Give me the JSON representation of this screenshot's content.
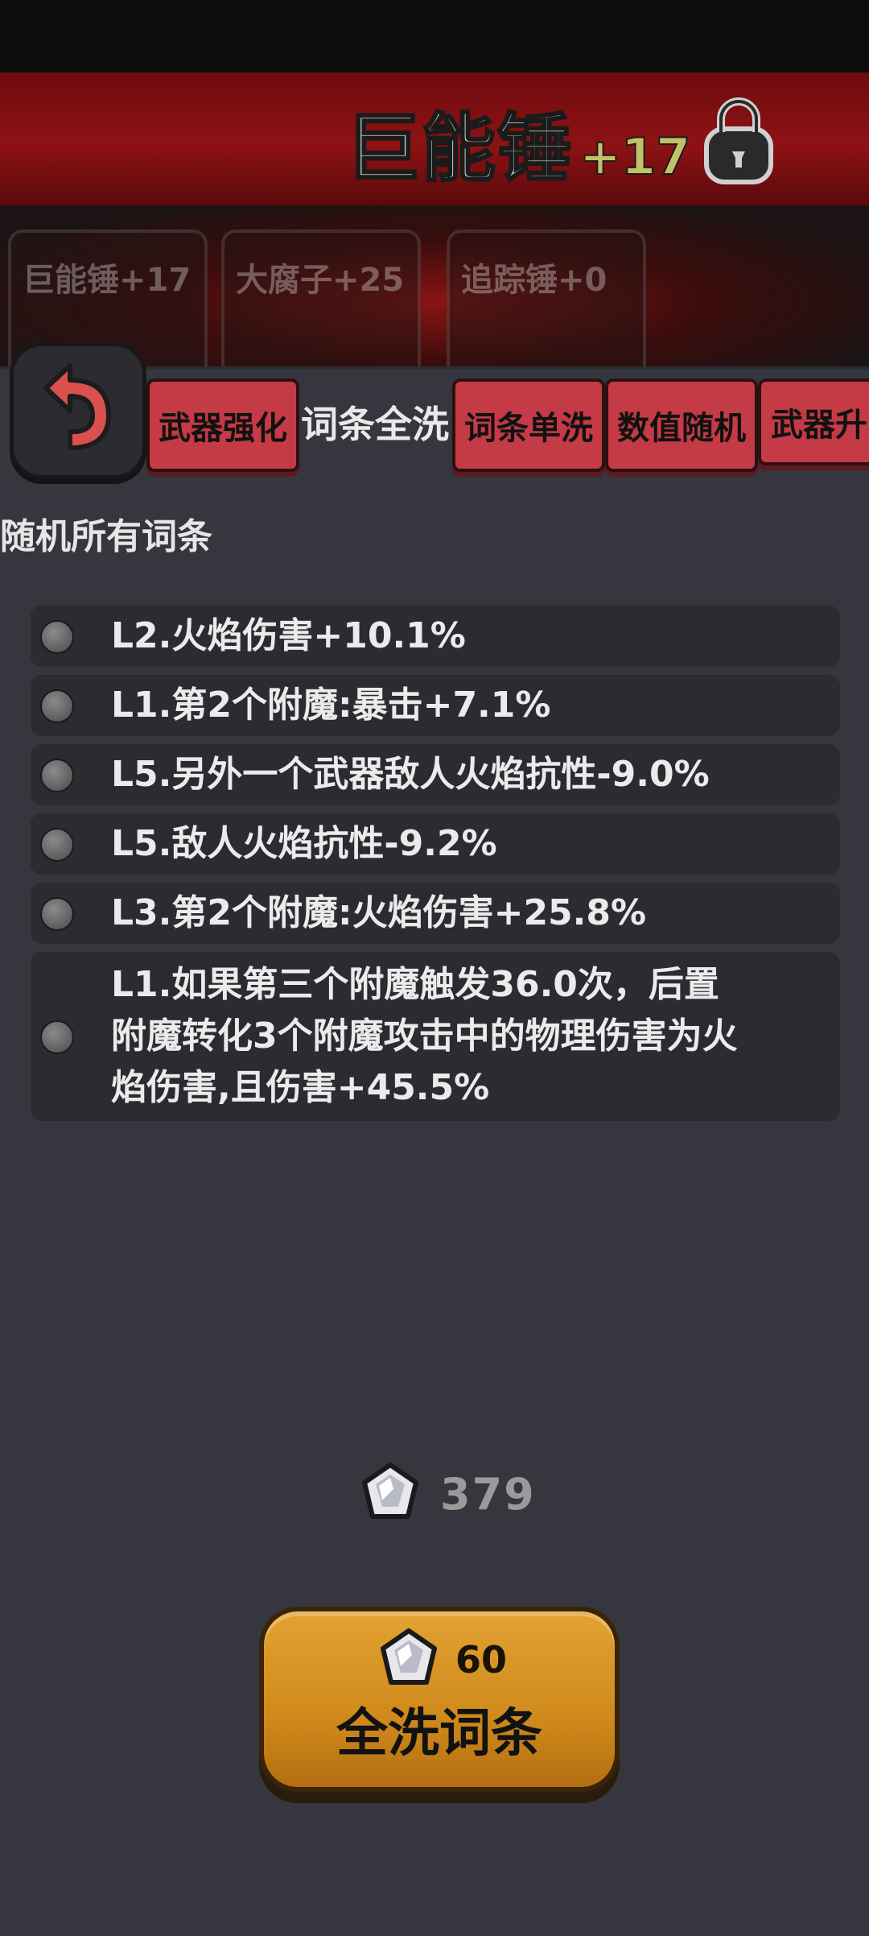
{
  "header": {
    "weapon_name": "巨能锤",
    "weapon_level": "+17"
  },
  "carousel": {
    "weapons": [
      "巨能锤+17",
      "大腐子+25",
      "追踪锤+0"
    ]
  },
  "tabs": [
    {
      "label": "武器强化",
      "active": false
    },
    {
      "label": "词条全洗",
      "active": true
    },
    {
      "label": "词条单洗",
      "active": false
    },
    {
      "label": "数值随机",
      "active": false
    },
    {
      "label": "武器升阶",
      "active": false
    }
  ],
  "section_title": "随机所有词条",
  "affixes": [
    "L2.火焰伤害+10.1%",
    "L1.第2个附魔:暴击+7.1%",
    "L5.另外一个武器敌人火焰抗性-9.0%",
    "L5.敌人火焰抗性-9.2%",
    "L3.第2个附魔:火焰伤害+25.8%",
    "L1.如果第三个附魔触发36.0次，后置附魔转化3个附魔攻击中的物理伤害为火焰伤害,且伤害+45.5%"
  ],
  "currency": {
    "icon": "crystal-gem-icon",
    "amount": "379"
  },
  "reroll_button": {
    "cost": "60",
    "label": "全洗词条"
  }
}
